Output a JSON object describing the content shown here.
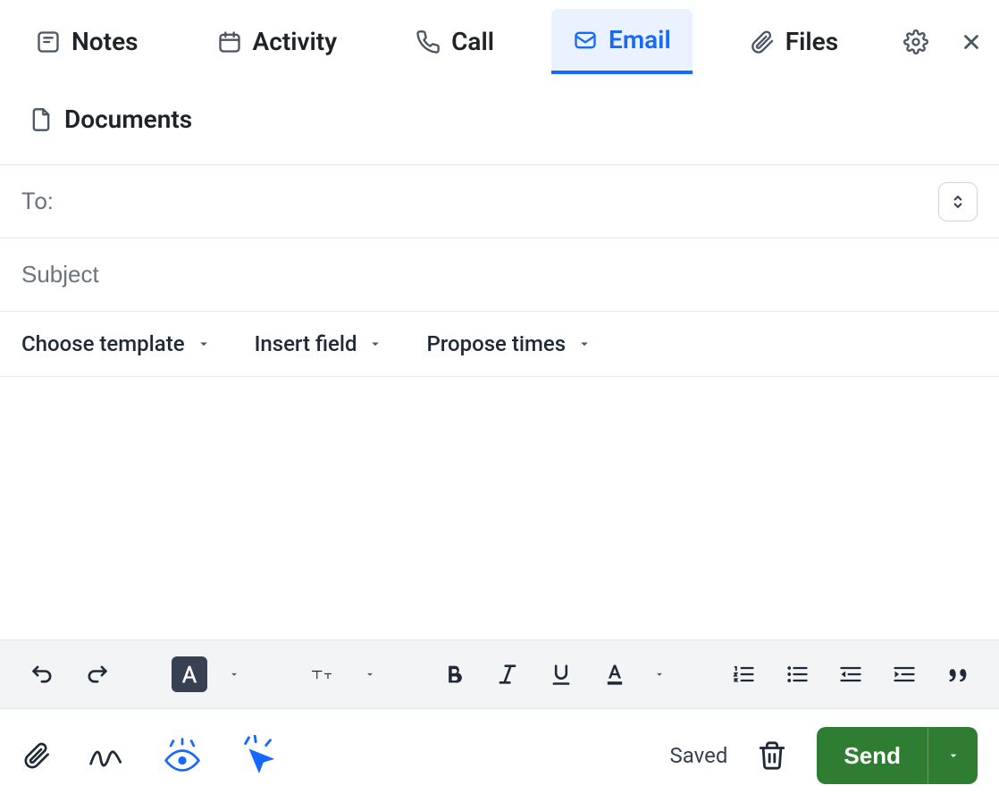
{
  "tabs": {
    "notes": "Notes",
    "activity": "Activity",
    "call": "Call",
    "email": "Email",
    "files": "Files",
    "documents": "Documents",
    "active": "email"
  },
  "fields": {
    "to_label": "To:",
    "to_value": "",
    "subject_placeholder": "Subject",
    "subject_value": ""
  },
  "dropdowns": {
    "choose_template": "Choose template",
    "insert_field": "Insert field",
    "propose_times": "Propose times"
  },
  "status": {
    "saved": "Saved"
  },
  "actions": {
    "send": "Send"
  }
}
